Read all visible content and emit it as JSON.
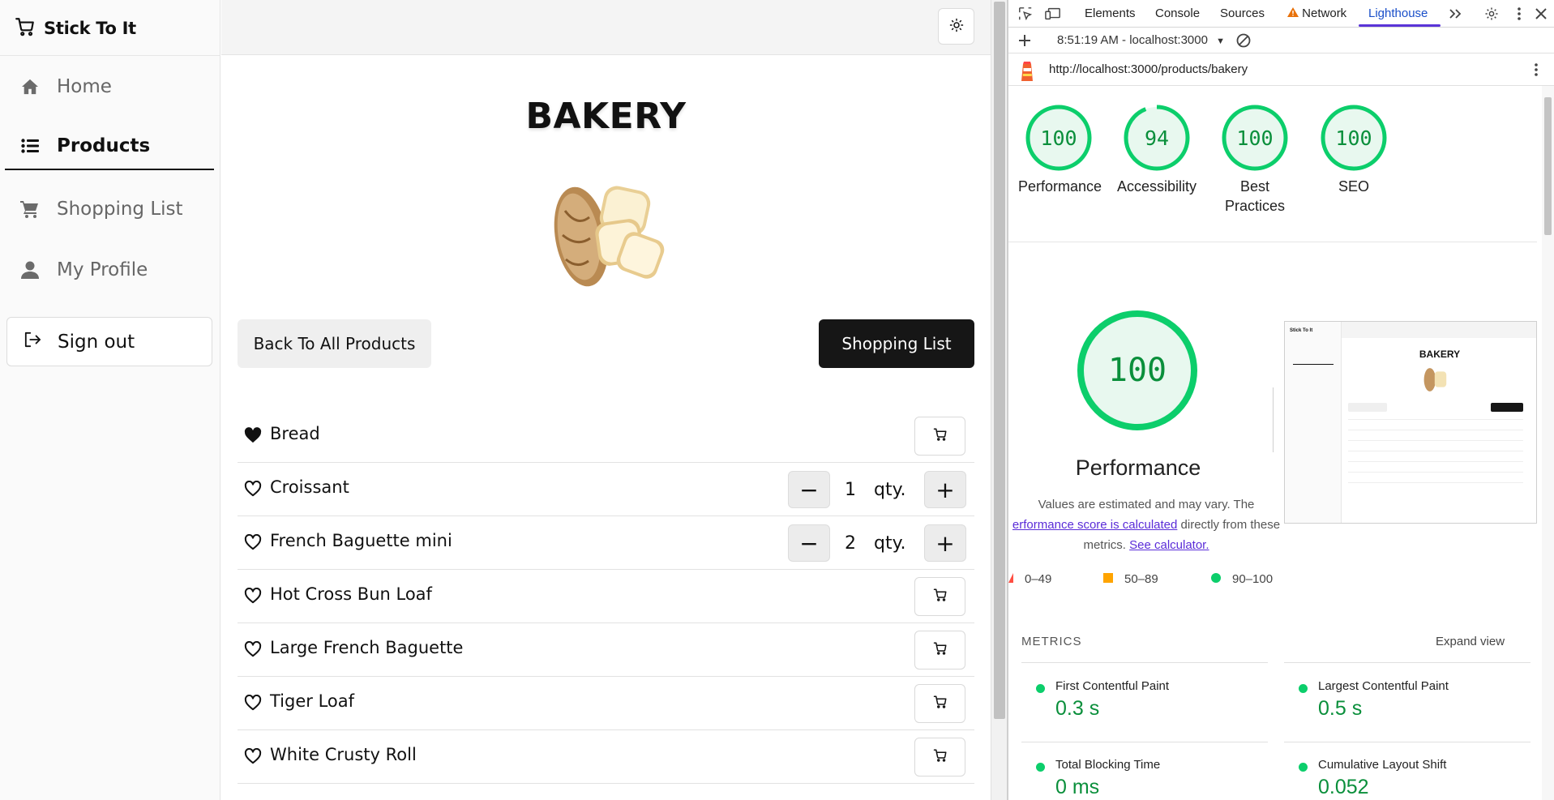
{
  "app": {
    "brand": "Stick To It",
    "nav": [
      {
        "label": "Home",
        "icon": "home-icon",
        "active": false
      },
      {
        "label": "Products",
        "icon": "list-icon",
        "active": true
      },
      {
        "label": "Shopping List",
        "icon": "cart-icon",
        "active": false
      },
      {
        "label": "My Profile",
        "icon": "user-icon",
        "active": false
      }
    ],
    "signout_label": "Sign out",
    "page_title": "BAKERY",
    "back_button": "Back To All Products",
    "list_button": "Shopping List",
    "qty_unit": "qty.",
    "products": [
      {
        "name": "Bread",
        "favorite": true,
        "qty": null
      },
      {
        "name": "Croissant",
        "favorite": false,
        "qty": "1"
      },
      {
        "name": "French Baguette mini",
        "favorite": false,
        "qty": "2"
      },
      {
        "name": "Hot Cross Bun Loaf",
        "favorite": false,
        "qty": null
      },
      {
        "name": "Large French Baguette",
        "favorite": false,
        "qty": null
      },
      {
        "name": "Tiger Loaf",
        "favorite": false,
        "qty": null
      },
      {
        "name": "White Crusty Roll",
        "favorite": false,
        "qty": null
      }
    ]
  },
  "devtools": {
    "tabs": [
      "Elements",
      "Console",
      "Sources",
      "Network",
      "Lighthouse"
    ],
    "active_tab": "Lighthouse",
    "report_time": "8:51:19 AM - localhost:3000",
    "url": "http://localhost:3000/products/bakery",
    "scores": [
      {
        "value": "100",
        "label": "Performance"
      },
      {
        "value": "94",
        "label": "Accessibility"
      },
      {
        "value": "100",
        "label": "Best Practices"
      },
      {
        "value": "100",
        "label": "SEO"
      }
    ],
    "perf_score": "100",
    "perf_title": "Performance",
    "note_prefix": "Values are estimated and may vary. The",
    "note_link1": "erformance score is calculated",
    "note_mid": "directly from these metrics.",
    "note_link2": "See calculator.",
    "legend": [
      "0–49",
      "50–89",
      "90–100"
    ],
    "metrics_heading": "METRICS",
    "expand_label": "Expand view",
    "metrics": [
      {
        "name": "First Contentful Paint",
        "value": "0.3 s"
      },
      {
        "name": "Largest Contentful Paint",
        "value": "0.5 s"
      },
      {
        "name": "Total Blocking Time",
        "value": "0 ms"
      },
      {
        "name": "Cumulative Layout Shift",
        "value": "0.052"
      }
    ],
    "thumb_title": "BAKERY",
    "thumb_brand": "Stick To It"
  },
  "colors": {
    "pass": "#0cce6b",
    "average": "#ffa400",
    "fail": "#ff4e42",
    "accent": "#5a34d8",
    "dark_button": "#161616"
  }
}
